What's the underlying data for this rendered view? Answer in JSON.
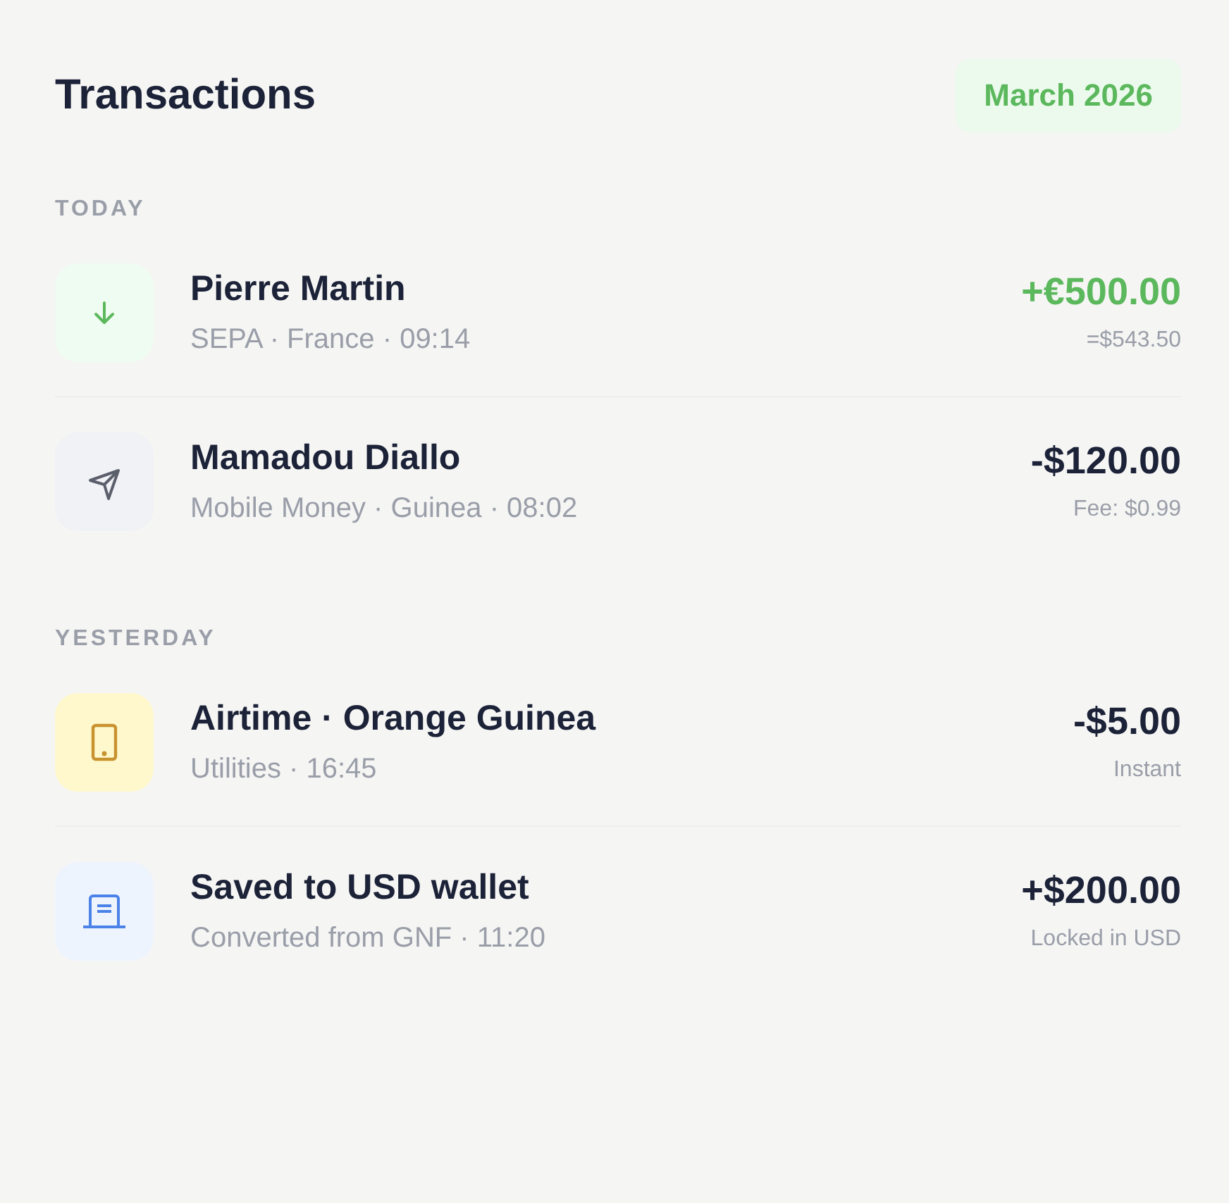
{
  "title": "Transactions",
  "period": "March 2026",
  "groups": [
    {
      "label": "TODAY",
      "items": [
        {
          "kind": "incoming",
          "name": "Pierre Martin",
          "meta": "SEPA · France · 09:14",
          "amount": "+€500.00",
          "highlight": true,
          "note": "=$543.50"
        },
        {
          "kind": "send",
          "name": "Mamadou Diallo",
          "meta": "Mobile Money · Guinea · 08:02",
          "amount": "-$120.00",
          "highlight": false,
          "note": "Fee: $0.99"
        }
      ]
    },
    {
      "label": "YESTERDAY",
      "items": [
        {
          "kind": "airtime",
          "name": "Airtime · Orange Guinea",
          "meta": "Utilities · 16:45",
          "amount": "-$5.00",
          "highlight": false,
          "note": "Instant"
        },
        {
          "kind": "savings",
          "name": "Saved to USD wallet",
          "meta": "Converted from GNF · 11:20",
          "amount": "+$200.00",
          "highlight": false,
          "note": "Locked in USD"
        }
      ]
    }
  ]
}
